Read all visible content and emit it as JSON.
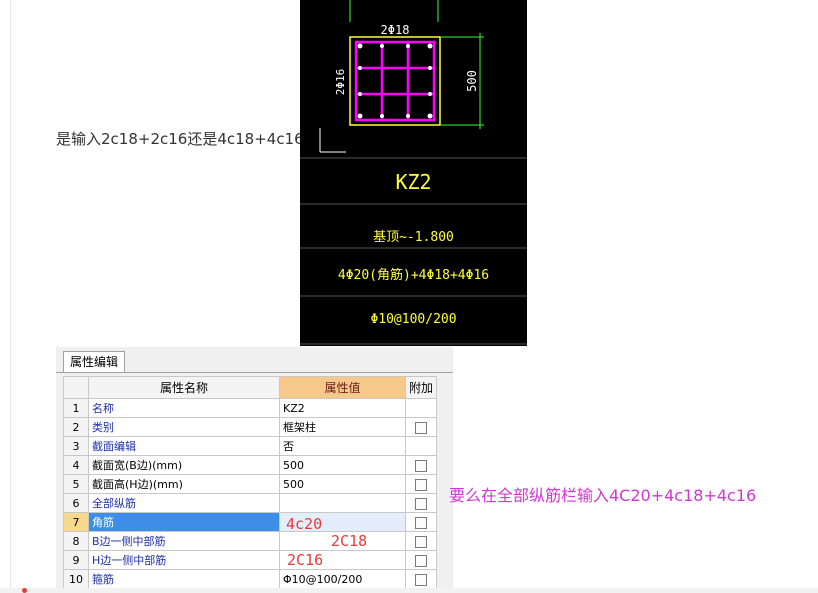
{
  "question": {
    "text": "是输入2c18+2c16还是4c18+4c16"
  },
  "cad": {
    "top_rebar_label": "2Φ18",
    "side_rebar_label": "2Φ16",
    "dimension": "500",
    "column_name": "KZ2",
    "elevation": "基顶~-1.800",
    "rebar_spec": "4Φ20(角筋)+4Φ18+4Φ16",
    "stirrup_spec": "Φ10@100/200",
    "line_color": "#ffff33",
    "rebar_color": "#ff00ff",
    "dim_color": "#33ff33"
  },
  "panel": {
    "tab_label": "属性编辑",
    "columns": {
      "index": "",
      "name": "属性名称",
      "value": "属性值",
      "extra": "附加"
    },
    "rows": [
      {
        "num": "1",
        "name": "名称",
        "value": "KZ2",
        "has_check": false,
        "blue": true
      },
      {
        "num": "2",
        "name": "类别",
        "value": "框架柱",
        "has_check": true,
        "blue": true
      },
      {
        "num": "3",
        "name": "截面编辑",
        "value": "否",
        "has_check": false,
        "blue": true
      },
      {
        "num": "4",
        "name": "截面宽(B边)(mm)",
        "value": "500",
        "has_check": true,
        "blue": false
      },
      {
        "num": "5",
        "name": "截面高(H边)(mm)",
        "value": "500",
        "has_check": true,
        "blue": false
      },
      {
        "num": "6",
        "name": "全部纵筋",
        "value": "",
        "has_check": true,
        "blue": true
      },
      {
        "num": "7",
        "name": "角筋",
        "value": "",
        "has_check": true,
        "blue": true,
        "selected": true
      },
      {
        "num": "8",
        "name": "B边一侧中部筋",
        "value": "",
        "has_check": true,
        "blue": true
      },
      {
        "num": "9",
        "name": "H边一侧中部筋",
        "value": "",
        "has_check": true,
        "blue": true
      },
      {
        "num": "10",
        "name": "箍筋",
        "value": "Φ10@100/200",
        "has_check": true,
        "blue": true
      }
    ]
  },
  "handwriting": {
    "corner": "4c20",
    "b_side": "2C18",
    "h_side": "2C16",
    "color": "#e53a3a"
  },
  "note": {
    "text": "要么在全部纵筋栏输入4C20+4c18+4c16",
    "color": "#d435d4"
  }
}
